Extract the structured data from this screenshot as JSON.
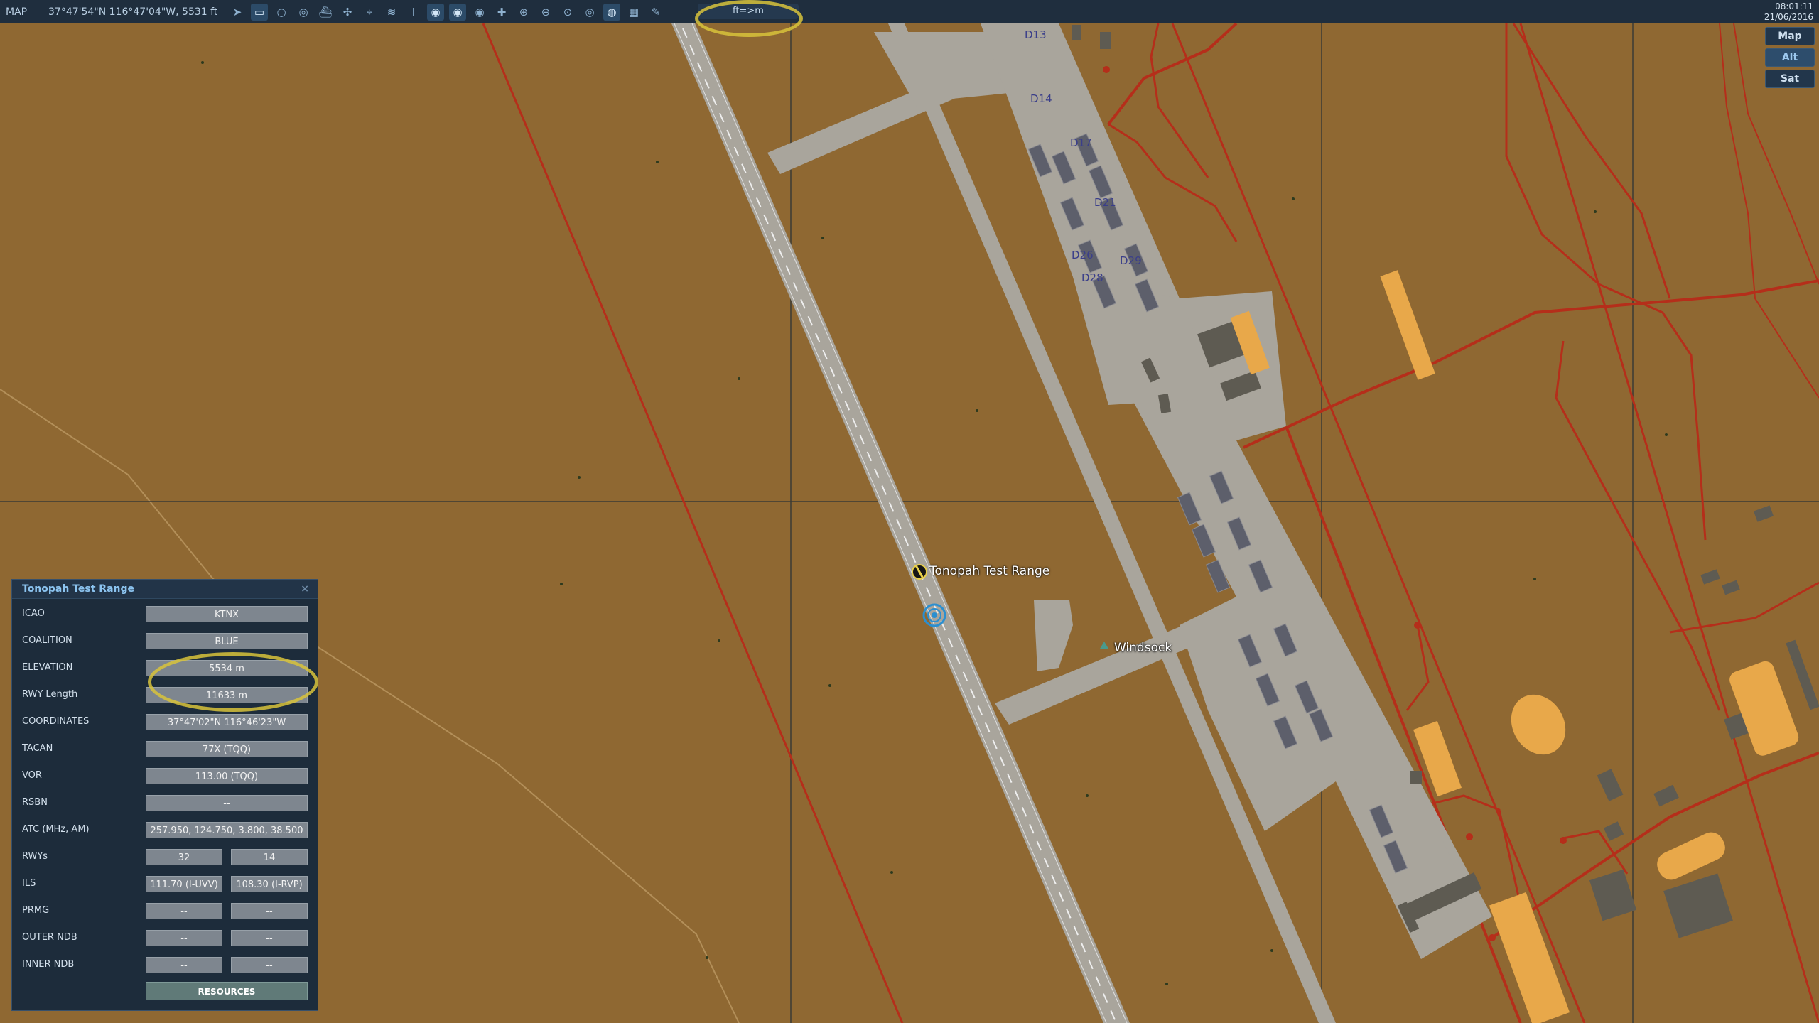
{
  "topbar": {
    "mode": "MAP",
    "cursor_coords": "37°47'54\"N 116°47'04\"W, 5531 ft",
    "unit_toggle": "ft=>m",
    "time": "08:01:11",
    "date": "21/06/2016",
    "tool_icons": [
      "pointer-icon",
      "ruler-icon",
      "circle-icon",
      "multi-circle-icon",
      "ship-icon",
      "units-icon",
      "target-icon",
      "radio-icon",
      "tower-icon",
      "filter-a-icon",
      "filter-b-icon",
      "filter-c-icon",
      "cross-icon",
      "zoom-in-icon",
      "zoom-out-icon",
      "zoom-fit-icon",
      "radar-icon",
      "globe-icon",
      "grid-icon",
      "pencil-icon"
    ]
  },
  "layers": {
    "items": [
      {
        "label": "Map",
        "active": false
      },
      {
        "label": "Alt",
        "active": true
      },
      {
        "label": "Sat",
        "active": false
      }
    ]
  },
  "map_labels": {
    "airfield": "Tonopah Test Range",
    "windsock": "Windsock",
    "parking": [
      "D13",
      "D14",
      "D17",
      "D21",
      "D26",
      "D29",
      "D28"
    ]
  },
  "panel": {
    "title": "Tonopah Test Range",
    "close": "×",
    "rows": [
      {
        "label": "ICAO",
        "values": [
          "KTNX"
        ]
      },
      {
        "label": "COALITION",
        "values": [
          "BLUE"
        ]
      },
      {
        "label": "ELEVATION",
        "values": [
          "5534 m"
        ]
      },
      {
        "label": "RWY Length",
        "values": [
          "11633 m"
        ]
      },
      {
        "label": "COORDINATES",
        "values": [
          "37°47'02\"N 116°46'23\"W"
        ]
      },
      {
        "label": "TACAN",
        "values": [
          "77X (TQQ)"
        ]
      },
      {
        "label": "VOR",
        "values": [
          "113.00 (TQQ)"
        ]
      },
      {
        "label": "RSBN",
        "values": [
          "--"
        ]
      },
      {
        "label": "ATC  (MHz, AM)",
        "values": [
          "257.950, 124.750, 3.800, 38.500"
        ]
      },
      {
        "label": "RWYs",
        "values": [
          "32",
          "14"
        ]
      },
      {
        "label": "ILS",
        "values": [
          "111.70 (I-UVV)",
          "108.30 (I-RVP)"
        ]
      },
      {
        "label": "PRMG",
        "values": [
          "--",
          "--"
        ]
      },
      {
        "label": "OUTER NDB",
        "values": [
          "--",
          "--"
        ]
      },
      {
        "label": "INNER NDB",
        "values": [
          "--",
          "--"
        ]
      }
    ],
    "resources_button": "RESOURCES"
  },
  "colors": {
    "terrain": "#8f6832",
    "road": "#b52e1a",
    "tarmac": "#a9a59c",
    "building": "#5e5b52",
    "highlight": "#e8a84a",
    "bar": "#1f2e3e"
  }
}
